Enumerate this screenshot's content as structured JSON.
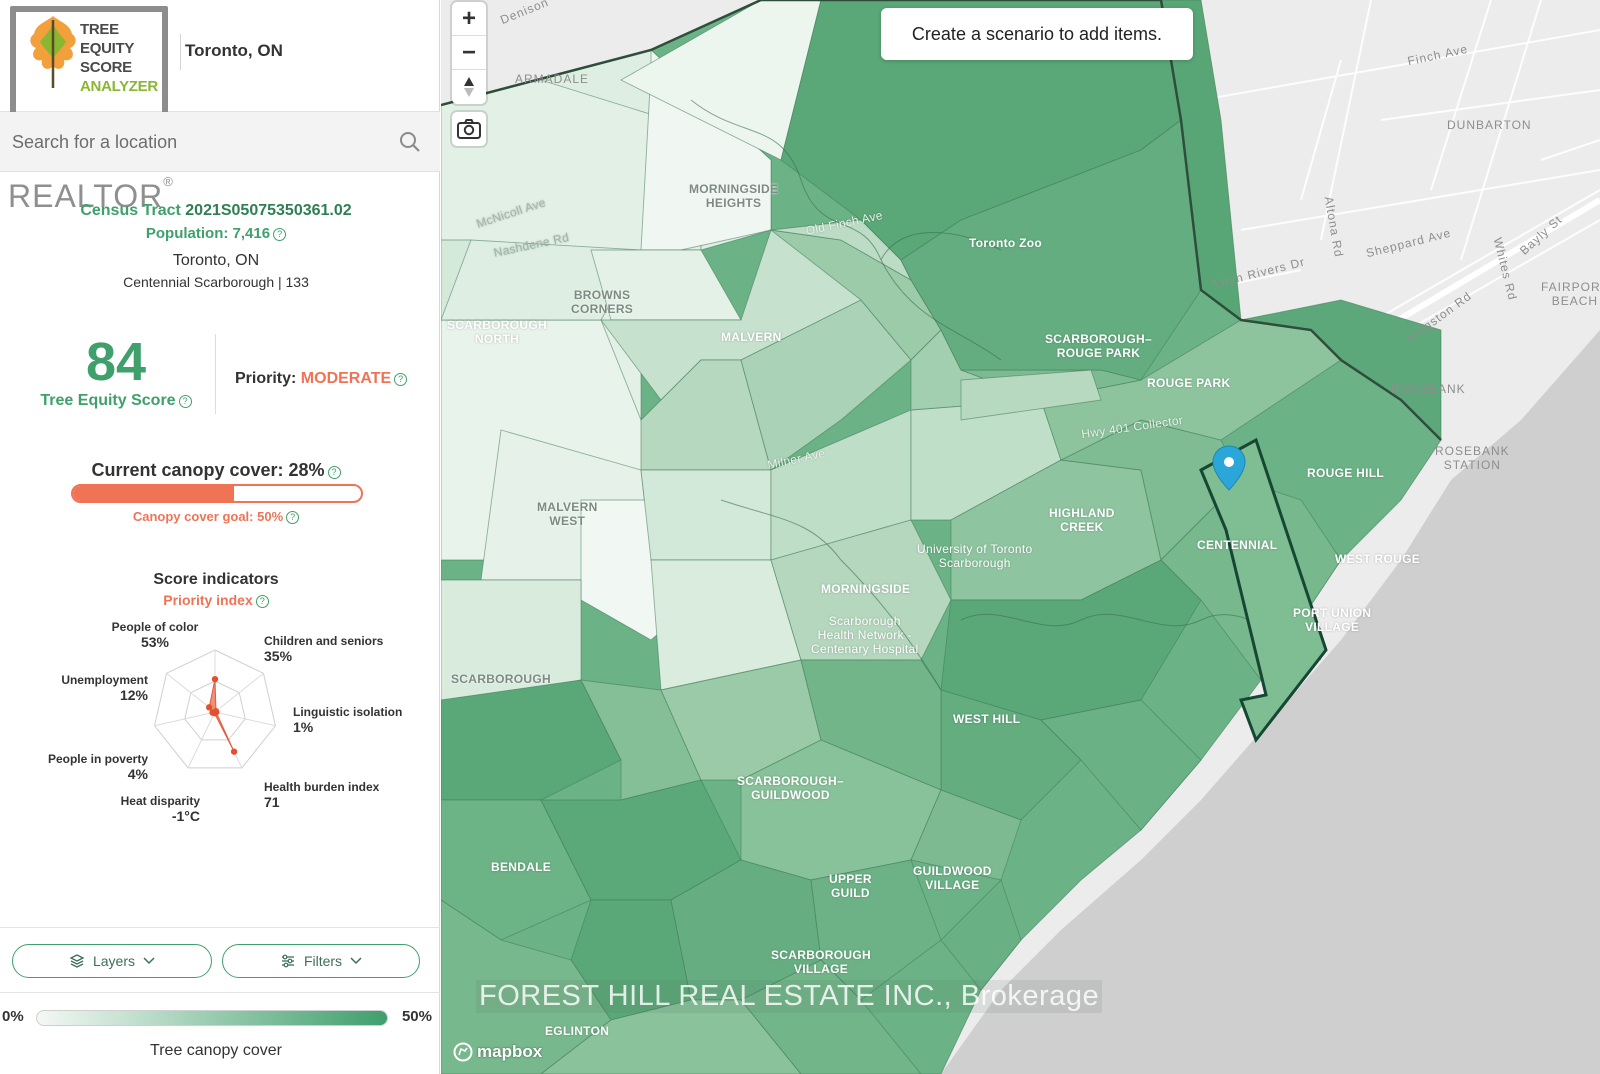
{
  "header": {
    "logo_lines": [
      "TREE",
      "EQUITY",
      "SCORE",
      "ANALYZER"
    ],
    "city": "Toronto, ON"
  },
  "search": {
    "placeholder": "Search for a location"
  },
  "watermark": {
    "realtor": "REALTOR",
    "brokerage": "FOREST HILL REAL ESTATE INC., Brokerage"
  },
  "tract": {
    "label": "Census Tract",
    "id": "2021S05075350361.02",
    "population": "Population: 7,416",
    "location": "Toronto, ON",
    "subarea": "Centennial Scarborough | 133"
  },
  "score": {
    "value": "84",
    "label": "Tree Equity Score",
    "priority_label": "Priority:",
    "priority_value": "MODERATE"
  },
  "canopy": {
    "title": "Current canopy cover: 28%",
    "fraction": 0.56,
    "goal": "Canopy cover goal: 50%"
  },
  "indicators": {
    "title": "Score indicators",
    "subtitle": "Priority index",
    "items": [
      {
        "name": "People of color",
        "value": "53%",
        "level": 0.53
      },
      {
        "name": "Children and seniors",
        "value": "35%",
        "level": 0.0
      },
      {
        "name": "Linguistic isolation",
        "value": "1%",
        "level": 0.01
      },
      {
        "name": "Health burden index",
        "value": "71",
        "level": 0.71
      },
      {
        "name": "Heat disparity",
        "value": "-1°C",
        "level": 0.0
      },
      {
        "name": "People in poverty",
        "value": "4%",
        "level": 0.04
      },
      {
        "name": "Unemployment",
        "value": "12%",
        "level": 0.12
      }
    ]
  },
  "controls": {
    "layers": "Layers",
    "filters": "Filters"
  },
  "legend": {
    "min": "0%",
    "max": "50%",
    "caption": "Tree canopy cover"
  },
  "map": {
    "tooltip": "Create a scenario to add items.",
    "attribution": "mapbox",
    "zoom_in": "+",
    "zoom_out": "−",
    "labels": {
      "morningside_heights": "MORNINGSIDE\nHEIGHTS",
      "toronto_zoo": "Toronto Zoo",
      "browns_corners": "BROWNS\nCORNERS",
      "scarborough_north": "SCARBOROUGH\nNORTH",
      "malvern": "MALVERN",
      "scarborough_rouge_park": "SCARBOROUGH–\nROUGE PARK",
      "rouge_park": "ROUGE PARK",
      "rouge_hill": "ROUGE HILL",
      "malvern_west": "MALVERN\nWEST",
      "highland_creek": "HIGHLAND\nCREEK",
      "centennial": "CENTENNIAL",
      "west_rouge": "WEST ROUGE",
      "uoft_scarborough": "University of Toronto\nScarborough",
      "morningside": "MORNINGSIDE",
      "scarborough_health": "Scarborough\nHealth Network -\nCentenary Hospital",
      "port_union": "PORT UNION\nVILLAGE",
      "scarborough": "SCARBOROUGH",
      "west_hill": "WEST HILL",
      "scarborough_guildwood": "SCARBOROUGH–\nGUILDWOOD",
      "bendale": "BENDALE",
      "upper_guild": "UPPER\nGUILD",
      "guildwood_village": "GUILDWOOD\nVILLAGE",
      "scarborough_village": "SCARBOROUGH\nVILLAGE",
      "eglinton": "EGLINTON",
      "armadale": "ARMADALE",
      "dunbarton": "DUNBARTON",
      "rosebank": "ROSEBANK",
      "rosebank_station": "ROSEBANK\nSTATION",
      "fairport_beach": "FAIRPORT\nBEACH",
      "finch_ave": "Finch Ave",
      "sheppard_ave": "Sheppard Ave",
      "altona_rd": "Altona Rd",
      "whites_rd": "Whites Rd",
      "kingston_rd": "Kingston Rd",
      "rouge_rivers_dr": "Twyn Rivers Dr",
      "bayly_st": "Bayly St",
      "denison": "Denison",
      "hwy401": "Hwy 401 Collector",
      "milner_ave": "Milner Ave",
      "old_finch": "Old Finch Ave",
      "mcnicoll": "McNicoll Ave",
      "nashdene": "Nashdene Rd"
    },
    "colors": {
      "green_dark": "#4e9e6c",
      "green_mid": "#6db387",
      "green_light": "#a8d4b5",
      "green_pale": "#d9ecdd",
      "water": "#cfcfcf",
      "land": "#ececec"
    }
  }
}
